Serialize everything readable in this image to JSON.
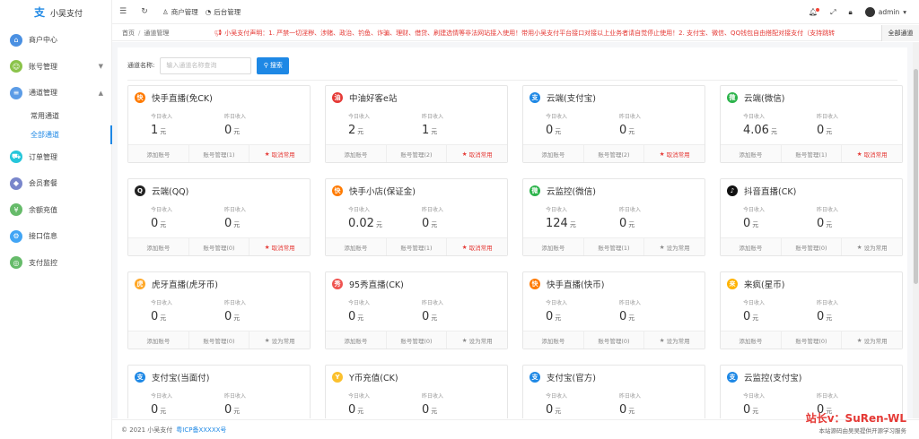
{
  "app": {
    "name": "小吴支付"
  },
  "sidebar": {
    "items": [
      {
        "label": "商户中心",
        "icon": "home-icon",
        "color": "#4a90e2"
      },
      {
        "label": "账号管理",
        "icon": "user-icon",
        "color": "#8bc34a",
        "arrow": "▼"
      },
      {
        "label": "通道管理",
        "icon": "channel-icon",
        "color": "#5c9ce6",
        "arrow": "▲"
      },
      {
        "label": "订单管理",
        "icon": "cart-icon",
        "color": "#26c6da"
      },
      {
        "label": "会员套餐",
        "icon": "diamond-icon",
        "color": "#7986cb"
      },
      {
        "label": "余额充值",
        "icon": "wallet-icon",
        "color": "#66bb6a"
      },
      {
        "label": "接口信息",
        "icon": "api-icon",
        "color": "#42a5f5"
      },
      {
        "label": "支付监控",
        "icon": "monitor-icon",
        "color": "#66bb6a"
      }
    ],
    "subitems": [
      {
        "label": "常用通道"
      },
      {
        "label": "全部通道"
      }
    ]
  },
  "header": {
    "tab_merchant": "商户管理",
    "tab_admin": "后台管理",
    "user": "admin"
  },
  "breadcrumb": {
    "home": "首页",
    "current": "通道管理",
    "notice": "小吴支付声明：1. 严禁一切淫秽、涉赌、政治、钓鱼、诈骗、理财、借贷、刷建选情等非法网站接入使用！带用小吴支付平台接口对接以上业务者请自觉停止使用！2. 支付宝、微信、QQ钱包自由搭配对接支付（支持跳转",
    "all_tab": "全部通道"
  },
  "search": {
    "label": "通道名称:",
    "placeholder": "输入通道名称查询",
    "button": "搜索"
  },
  "card_labels": {
    "today": "今日收入",
    "yesterday": "昨日收入",
    "unit": "元",
    "add_account": "添加账号",
    "cancel_common": "取消常用",
    "set_common": "设为常用"
  },
  "channels": [
    {
      "name": "快手直播(免CK)",
      "icon": "kuaishou-icon",
      "color": "#ff7a00",
      "glyph": "快",
      "today": "1",
      "yesterday": "0",
      "accounts": "账号管理(1)",
      "common": true
    },
    {
      "name": "中油好客e站",
      "icon": "petrochina-icon",
      "color": "#e53935",
      "glyph": "油",
      "today": "2",
      "yesterday": "1",
      "accounts": "账号管理(2)",
      "common": true
    },
    {
      "name": "云端(支付宝)",
      "icon": "alipay-icon",
      "color": "#1e88e5",
      "glyph": "支",
      "today": "0",
      "yesterday": "0",
      "accounts": "账号管理(2)",
      "common": true
    },
    {
      "name": "云端(微信)",
      "icon": "wechat-icon",
      "color": "#2bb34a",
      "glyph": "微",
      "today": "4.06",
      "yesterday": "0",
      "accounts": "账号管理(1)",
      "common": true
    },
    {
      "name": "云端(QQ)",
      "icon": "qq-icon",
      "color": "#222222",
      "glyph": "Q",
      "today": "0",
      "yesterday": "0",
      "accounts": "账号管理(0)",
      "common": true
    },
    {
      "name": "快手小店(保证金)",
      "icon": "kuaishou-icon",
      "color": "#ff7a00",
      "glyph": "快",
      "today": "0.02",
      "yesterday": "0",
      "accounts": "账号管理(1)",
      "common": true
    },
    {
      "name": "云监控(微信)",
      "icon": "wechat-icon",
      "color": "#2bb34a",
      "glyph": "微",
      "today": "124",
      "yesterday": "0",
      "accounts": "账号管理(1)",
      "common": false
    },
    {
      "name": "抖音直播(CK)",
      "icon": "douyin-icon",
      "color": "#111111",
      "glyph": "♪",
      "today": "0",
      "yesterday": "0",
      "accounts": "账号管理(0)",
      "common": false
    },
    {
      "name": "虎牙直播(虎牙币)",
      "icon": "huya-icon",
      "color": "#ffa726",
      "glyph": "虎",
      "today": "0",
      "yesterday": "0",
      "accounts": "账号管理(0)",
      "common": false
    },
    {
      "name": "95秀直播(CK)",
      "icon": "show95-icon",
      "color": "#ef5350",
      "glyph": "秀",
      "today": "0",
      "yesterday": "0",
      "accounts": "账号管理(0)",
      "common": false
    },
    {
      "name": "快手直播(快币)",
      "icon": "kuaishou-icon",
      "color": "#ff7a00",
      "glyph": "快",
      "today": "0",
      "yesterday": "0",
      "accounts": "账号管理(0)",
      "common": false
    },
    {
      "name": "来疯(星币)",
      "icon": "laifeng-icon",
      "color": "#ffb300",
      "glyph": "来",
      "today": "0",
      "yesterday": "0",
      "accounts": "账号管理(0)",
      "common": false
    },
    {
      "name": "支付宝(当面付)",
      "icon": "alipay-icon",
      "color": "#1e88e5",
      "glyph": "支",
      "today": "0",
      "yesterday": "0",
      "accounts": "",
      "common": false
    },
    {
      "name": "Y币充值(CK)",
      "icon": "ycoin-icon",
      "color": "#fbc02d",
      "glyph": "Y",
      "today": "0",
      "yesterday": "0",
      "accounts": "",
      "common": false
    },
    {
      "name": "支付宝(官方)",
      "icon": "alipay-icon",
      "color": "#1e88e5",
      "glyph": "支",
      "today": "0",
      "yesterday": "0",
      "accounts": "",
      "common": false
    },
    {
      "name": "云监控(支付宝)",
      "icon": "alipay-icon",
      "color": "#1e88e5",
      "glyph": "支",
      "today": "0",
      "yesterday": "0",
      "accounts": "",
      "common": false
    }
  ],
  "footer": {
    "copyright": "© 2021 小吴支付",
    "icp": "粤ICP备XXXXX号"
  },
  "watermark": {
    "line1": "站长v：SuRen-WL",
    "line2": "本站源码由吴吴提供开源学习服务"
  }
}
